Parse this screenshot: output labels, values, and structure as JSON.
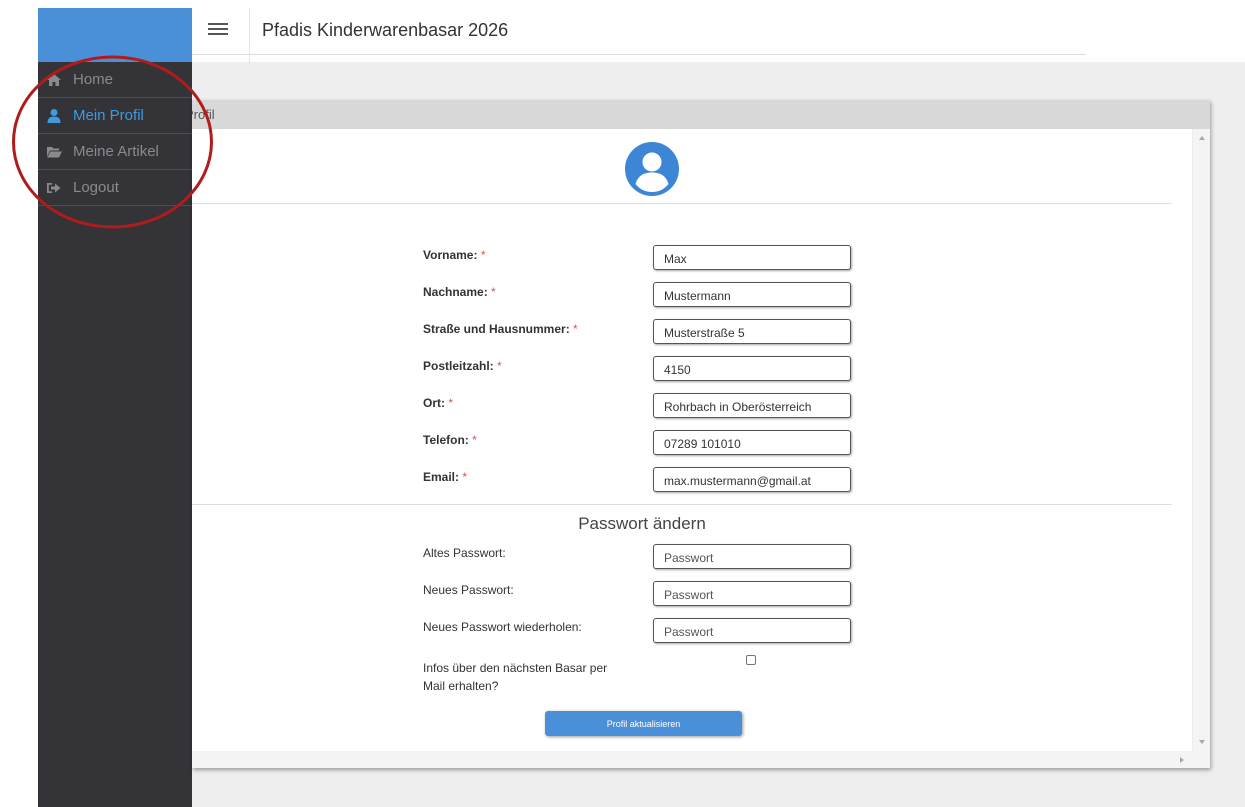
{
  "header": {
    "title": "Pfadis Kinderwarenbasar 2026"
  },
  "sidebar": {
    "items": [
      {
        "label": "Home",
        "icon": "home-icon"
      },
      {
        "label": "Mein Profil",
        "icon": "user-icon",
        "active": true
      },
      {
        "label": "Meine Artikel",
        "icon": "folder-open-icon"
      },
      {
        "label": "Logout",
        "icon": "sign-out-icon"
      }
    ]
  },
  "panel": {
    "title": "Profil"
  },
  "form": {
    "fields": [
      {
        "label": "Vorname:",
        "required": "*",
        "value": "Max"
      },
      {
        "label": "Nachname:",
        "required": "*",
        "value": "Mustermann"
      },
      {
        "label": "Straße und Hausnummer:",
        "required": "*",
        "value": "Musterstraße 5"
      },
      {
        "label": "Postleitzahl:",
        "required": "*",
        "value": "4150"
      },
      {
        "label": "Ort:",
        "required": "*",
        "value": "Rohrbach in Oberösterreich"
      },
      {
        "label": "Telefon:",
        "required": "*",
        "value": "07289 101010"
      },
      {
        "label": "Email:",
        "required": "*",
        "value": "max.mustermann@gmail.at"
      }
    ],
    "password_section": {
      "title": "Passwort ändern",
      "fields": [
        {
          "label": "Altes Passwort:",
          "placeholder": "Passwort"
        },
        {
          "label": "Neues Passwort:",
          "placeholder": "Passwort"
        },
        {
          "label": "Neues Passwort wiederholen:",
          "placeholder": "Passwort"
        }
      ]
    },
    "newsletter": {
      "label_line1": "Infos über den nächsten Basar per",
      "label_line2": "Mail erhalten?",
      "checked": false
    },
    "submit_label": "Profil aktualisieren"
  },
  "colors": {
    "sidebar_bg": "#333338",
    "sidebar_header": "#4a90d9",
    "active": "#3d9be0",
    "primary": "#4a90d9",
    "required": "#d9534f",
    "annotation": "#b01c1c"
  }
}
